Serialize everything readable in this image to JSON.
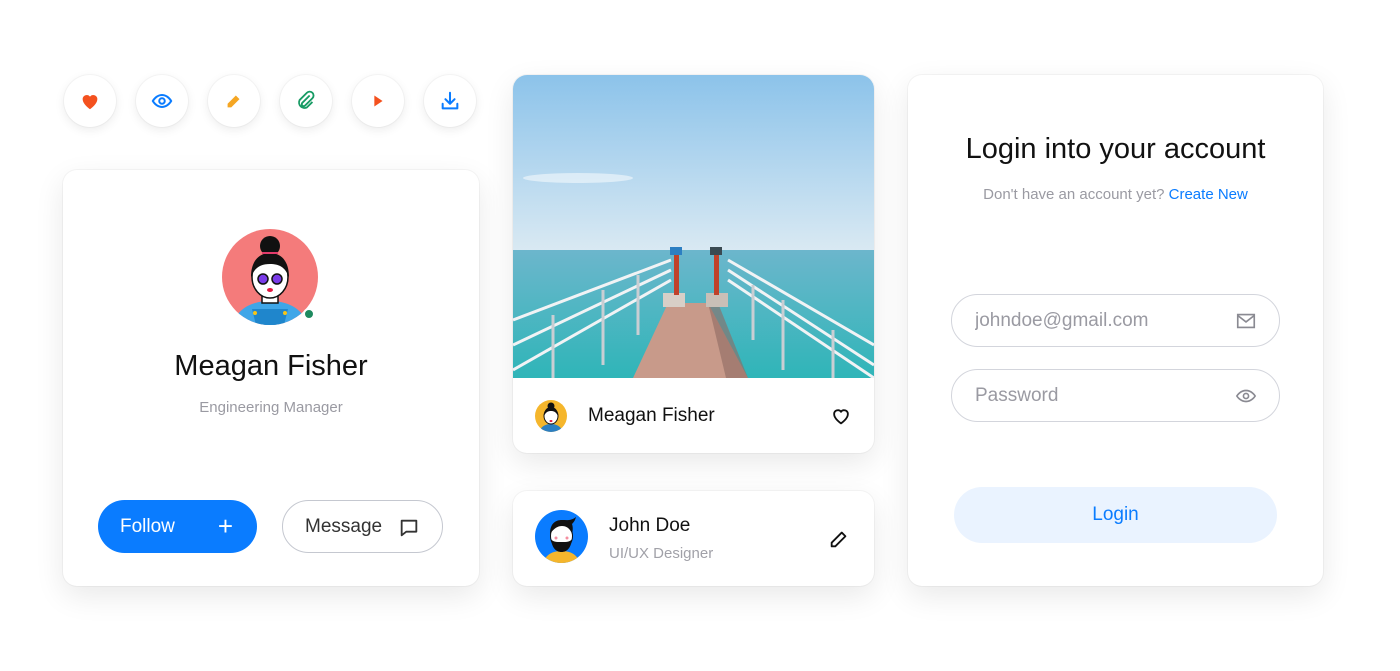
{
  "icon_buttons": [
    {
      "icon": "heart-icon",
      "color": "#f4511e"
    },
    {
      "icon": "eye-icon",
      "color": "#0a7cff"
    },
    {
      "icon": "pencil-icon",
      "color": "#f5a623"
    },
    {
      "icon": "paperclip-icon",
      "color": "#179b64"
    },
    {
      "icon": "play-icon",
      "color": "#f4511e"
    },
    {
      "icon": "download-icon",
      "color": "#0a7cff"
    }
  ],
  "profile_card": {
    "name": "Meagan Fisher",
    "role": "Engineering Manager",
    "status": "online",
    "follow_label": "Follow",
    "follow_icon": "+",
    "message_label": "Message"
  },
  "photo_card": {
    "author": "Meagan Fisher",
    "image_alt": "Pier over the ocean with binoculars"
  },
  "user_card": {
    "name": "John Doe",
    "role": "UI/UX Designer"
  },
  "login_card": {
    "title": "Login into your account",
    "subtitle": "Don't have an account yet?",
    "create_link": "Create New",
    "email_placeholder": "johndoe@gmail.com",
    "password_placeholder": "Password",
    "login_label": "Login"
  },
  "colors": {
    "accent": "#0a7cff",
    "online": "#1e8a5f",
    "muted_text": "#9a9aa2"
  }
}
